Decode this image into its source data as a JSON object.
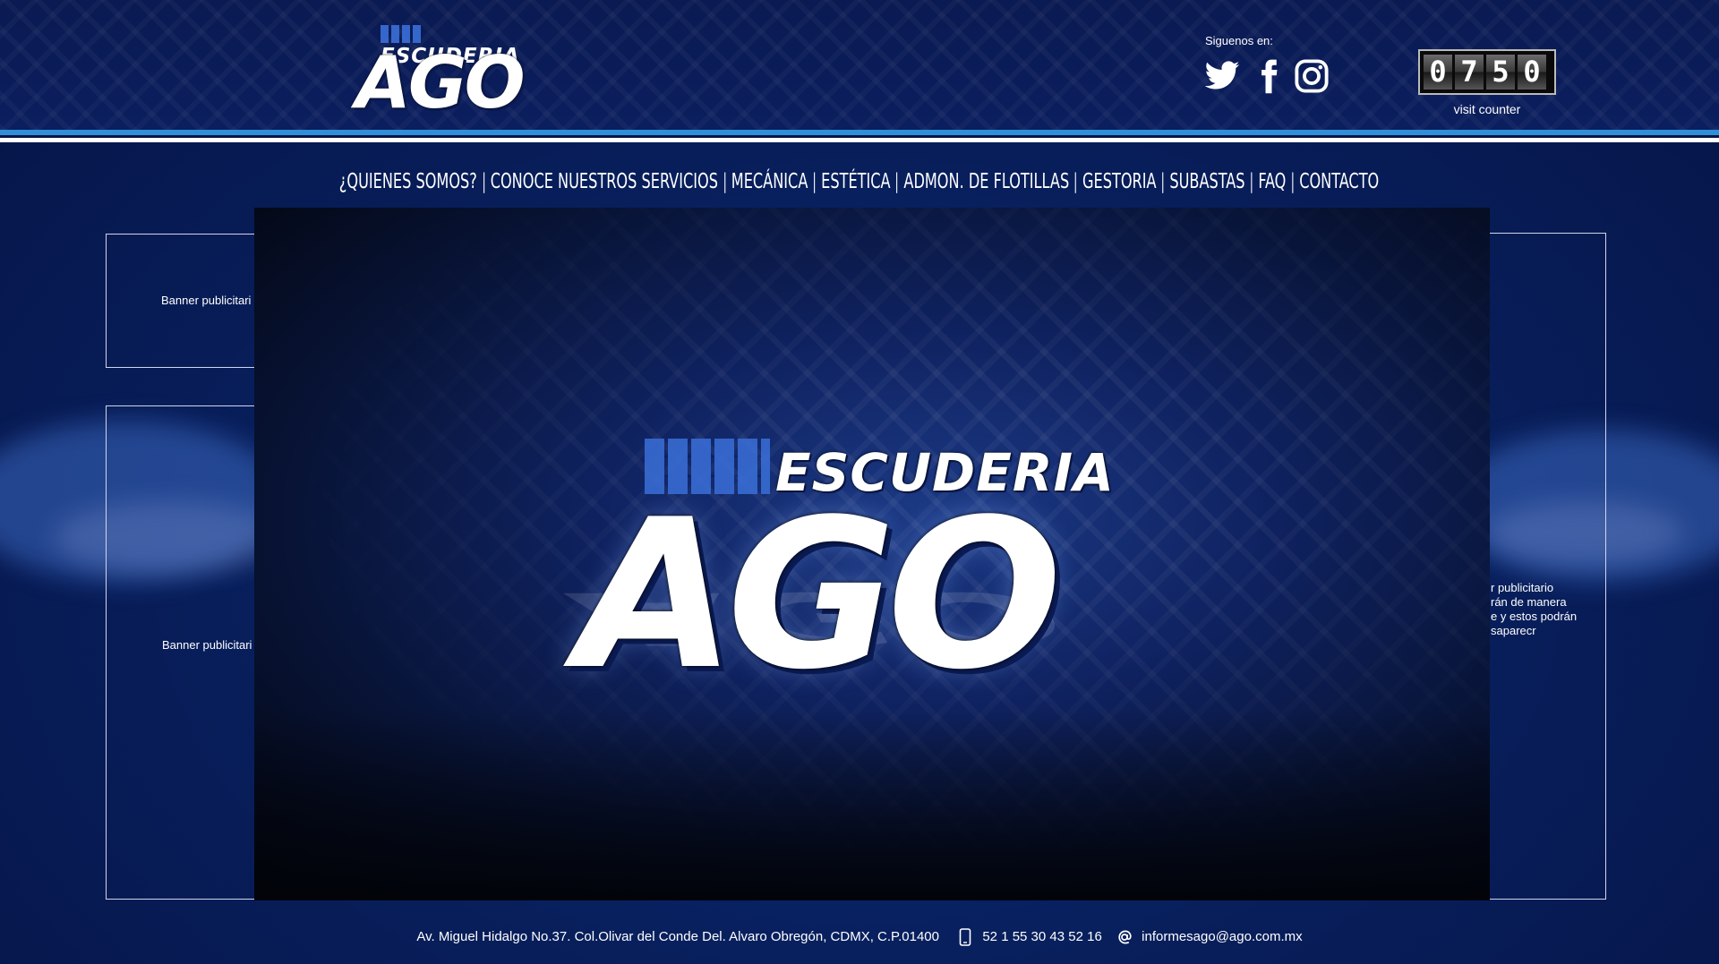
{
  "header": {
    "logo": {
      "top": "ESCUDERIA",
      "main": "AGO"
    },
    "social_label": "Siguenos en:",
    "social": [
      {
        "name": "twitter-icon"
      },
      {
        "name": "facebook-icon"
      },
      {
        "name": "instagram-icon"
      }
    ],
    "counter": {
      "digits": [
        "0",
        "7",
        "5",
        "0"
      ],
      "label": "visit counter"
    }
  },
  "nav": {
    "items": [
      "¿QUIENES SOMOS?",
      "CONOCE NUESTROS SERVICIOS",
      "MECÁNICA",
      "ESTÉTICA",
      "ADMON. DE FLOTILLAS",
      "GESTORIA",
      "SUBASTAS",
      "FAQ",
      "CONTACTO"
    ],
    "separator": "|"
  },
  "banners": {
    "left_top": "Banner publicitari",
    "left_bottom": "Banner publicitari",
    "right_lines": [
      "r publicitario",
      "rán de manera",
      "e y estos podrán",
      "saparecr"
    ]
  },
  "modal": {
    "logo_top": "ESCUDERIA",
    "logo_main": "AGO"
  },
  "footer": {
    "address": "Av. Miguel Hidalgo No.37. Col.Olivar del Conde Del. Alvaro Obregón, CDMX, C.P.01400",
    "phone": "52 1 55 30 43 52 16",
    "email": "informesago@ago.com.mx"
  },
  "colors": {
    "background": "#08205e",
    "accent_stripe": "#2f8fd8",
    "header": "#0a1a52"
  }
}
